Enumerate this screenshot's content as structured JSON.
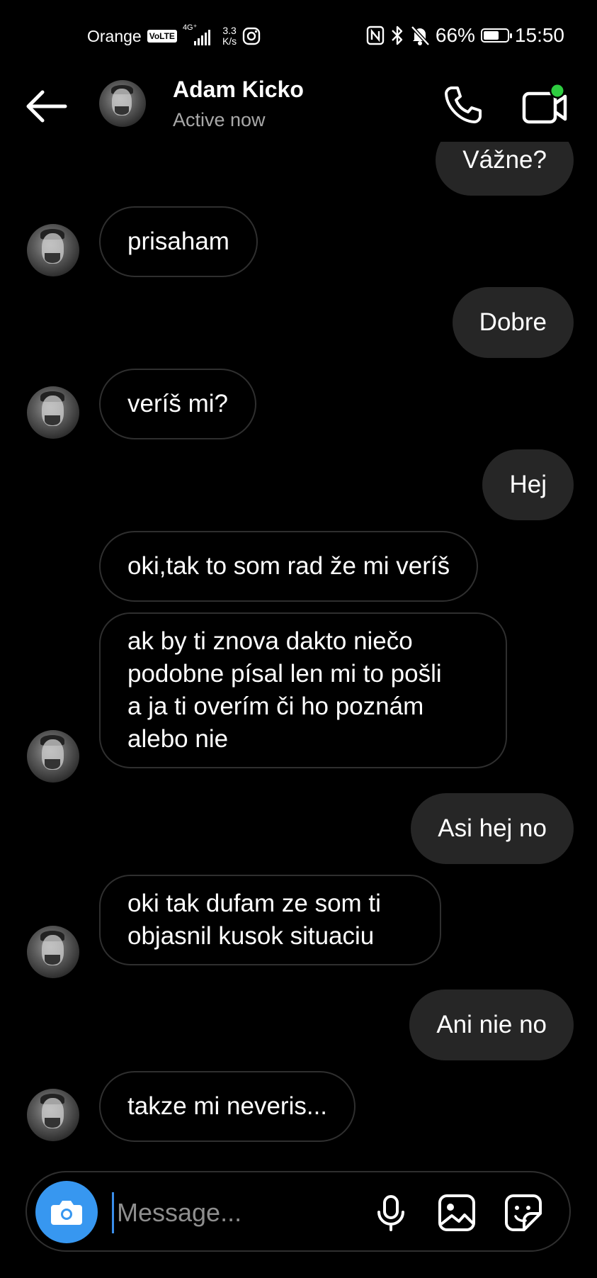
{
  "status_bar": {
    "carrier": "Orange",
    "volte": "VoLTE",
    "network": "4G⁺",
    "speed_value": "3.3",
    "speed_unit": "K/s",
    "battery": "66%",
    "battery_level": 0.66,
    "time": "15:50"
  },
  "header": {
    "name": "Adam Kicko",
    "status": "Active now"
  },
  "messages": [
    {
      "side": "out",
      "text": "Vážne?"
    },
    {
      "side": "in",
      "text": "prisaham"
    },
    {
      "side": "out",
      "text": "Dobre"
    },
    {
      "side": "in",
      "text": "veríš mi?"
    },
    {
      "side": "out",
      "text": "Hej"
    },
    {
      "side": "in",
      "text": "oki,tak to som rad že mi veríš"
    },
    {
      "side": "in",
      "lines": [
        "ak by ti znova dakto niečo",
        "podobne písal len mi to pošli",
        "a ja ti overím či ho poznám",
        "alebo nie"
      ]
    },
    {
      "side": "out",
      "text": "Asi hej no"
    },
    {
      "side": "in",
      "lines": [
        "oki tak dufam ze som ti",
        "objasnil kusok situaciu"
      ]
    },
    {
      "side": "out",
      "text": "Ani nie no"
    },
    {
      "side": "in",
      "text": "takze mi neveris..."
    }
  ],
  "composer": {
    "placeholder": "Message..."
  },
  "colors": {
    "background": "#000000",
    "outgoing_bubble": "#262626",
    "incoming_border": "#2f2f2f",
    "accent_blue": "#3797f0",
    "online_green": "#2ecc40",
    "secondary_text": "#a8a8a8"
  }
}
